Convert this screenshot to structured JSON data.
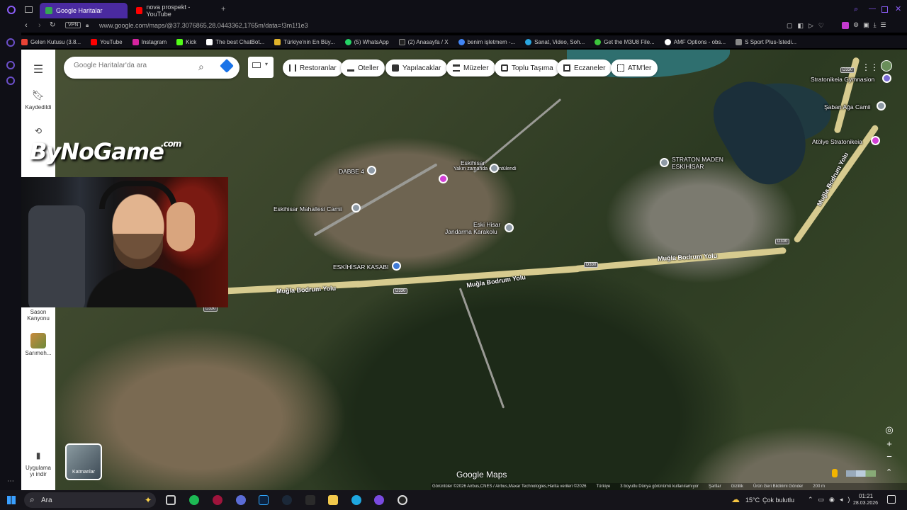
{
  "browser": {
    "tabs": [
      {
        "label": "Google Haritalar",
        "active": true
      },
      {
        "label": "nova prospekt - YouTube",
        "active": false
      }
    ],
    "vpn_badge": "VPN",
    "url": "www.google.com/maps/@37.3076865,28.0443362,1765m/data=!3m1!1e3",
    "bookmarks": [
      "Gelen Kutusu (3.8...",
      "YouTube",
      "Instagram",
      "Kick",
      "The best ChatBot...",
      "Türkiye'nin En Büy...",
      "(5) WhatsApp",
      "(2) Anasayfa / X",
      "benim işletmem -...",
      "Sanat, Video, Soh...",
      "Get the M3U8 File...",
      "AMF Options - obs...",
      "S Sport Plus-İstedi..."
    ]
  },
  "maps": {
    "search_placeholder": "Google Haritalar'da ara",
    "chips": [
      "Restoranlar",
      "Oteller",
      "Yapılacaklar",
      "Müzeler",
      "Toplu Taşıma",
      "Eczaneler",
      "ATM'ler"
    ],
    "sidebar": {
      "saved": "Kaydedildi",
      "item1": "Sason Kanyonu",
      "item2": "Sarımeh...",
      "app": "Uygulama yı indir"
    },
    "layers_label": "Katmanlar",
    "logo": "Google Maps",
    "places": {
      "dabbe": "DABBE 4",
      "eskihisar_top": "Eskihisar",
      "eskihisar_sub": "Yakın zamanda görüntülendi",
      "camii": "Eskihisar Mahallesi Camii",
      "jandarma1": "Eski Hisar",
      "jandarma2": "Jandarma Karakolu",
      "kasap": "ESKİHİSAR KASABI",
      "straton1": "STRATON MADEN",
      "straton2": "ESKİHİSAR",
      "gymnasion": "Stratonikeia Gymnasion",
      "saban": "Şaban Ağa Camii",
      "atolye": "Atölye Stratonikeia"
    },
    "roads": {
      "mb1": "Muğla Bodrum Yolu",
      "mb2": "Muğla Bodrum Yolu",
      "mb3": "Muğla Bodrum Yolu",
      "mb4": "Muğla Bodrum Yolu",
      "shield": "D330"
    },
    "attribution": [
      "Görüntüler ©2026 Airbus,CNES / Airbus,Maxar Technologies,Harita verileri ©2026",
      "Türkiye",
      "3 boyutlu Dünya görünümü kullanılamıyor",
      "Şartlar",
      "Gizlilik",
      "Ürün Geri Bildirimi Gönder",
      "200 m"
    ]
  },
  "overlay": {
    "watermark": "ByNoGame",
    "watermark_suffix": ".com"
  },
  "taskbar": {
    "search": "Ara",
    "weather": "15°C",
    "weather_desc": "Çok bulutlu",
    "time": "01:21",
    "date": "28.03.2026"
  }
}
